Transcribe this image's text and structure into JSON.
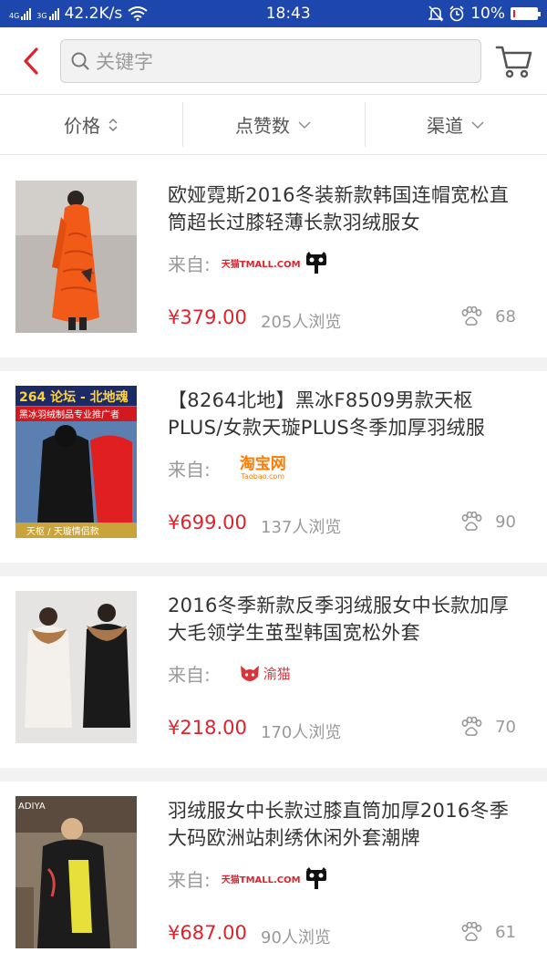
{
  "status_bar": {
    "network_speed": "42.2K/s",
    "time": "18:43",
    "battery": "10%",
    "battery_level": 0.1
  },
  "search": {
    "placeholder": "关键字"
  },
  "filters": [
    {
      "label": "价格"
    },
    {
      "label": "点赞数"
    },
    {
      "label": "渠道"
    }
  ],
  "source_label": "来自:",
  "products": [
    {
      "title": "欧娅霓斯2016冬装新款韩国连帽宽松直筒超长过膝轻薄长款羽绒服女",
      "source": "tmall",
      "source_text": "天猫TMALL.COM",
      "price": "¥379.00",
      "views": "205人浏览",
      "likes": "68",
      "colors": {
        "main": "#f25a18",
        "bg": "#c8c4c0"
      }
    },
    {
      "title": "【8264北地】黑冰F8509男款天枢PLUS/女款天璇PLUS冬季加厚羽绒服",
      "source": "taobao",
      "source_text": "淘宝网",
      "source_sub": "Taobao.com",
      "price": "¥699.00",
      "views": "137人浏览",
      "likes": "90",
      "thumb_text": {
        "top": "264 论坛 - 北地魂",
        "banner": "黑冰羽绒制品专业推广者",
        "bottom": "天枢 / 天璇情侣款"
      }
    },
    {
      "title": "2016冬季新款反季羽绒服女中长款加厚大毛领学生茧型韩国宽松外套",
      "source": "yumao",
      "source_text": "渝猫",
      "price": "¥218.00",
      "views": "170人浏览",
      "likes": "70"
    },
    {
      "title": "羽绒服女中长款过膝直筒加厚2016冬季大码欧洲站刺绣休闲外套潮牌",
      "source": "tmall",
      "source_text": "天猫TMALL.COM",
      "price": "¥687.00",
      "views": "90人浏览",
      "likes": "61",
      "thumb_text": {
        "top": "ADIYA"
      }
    }
  ]
}
